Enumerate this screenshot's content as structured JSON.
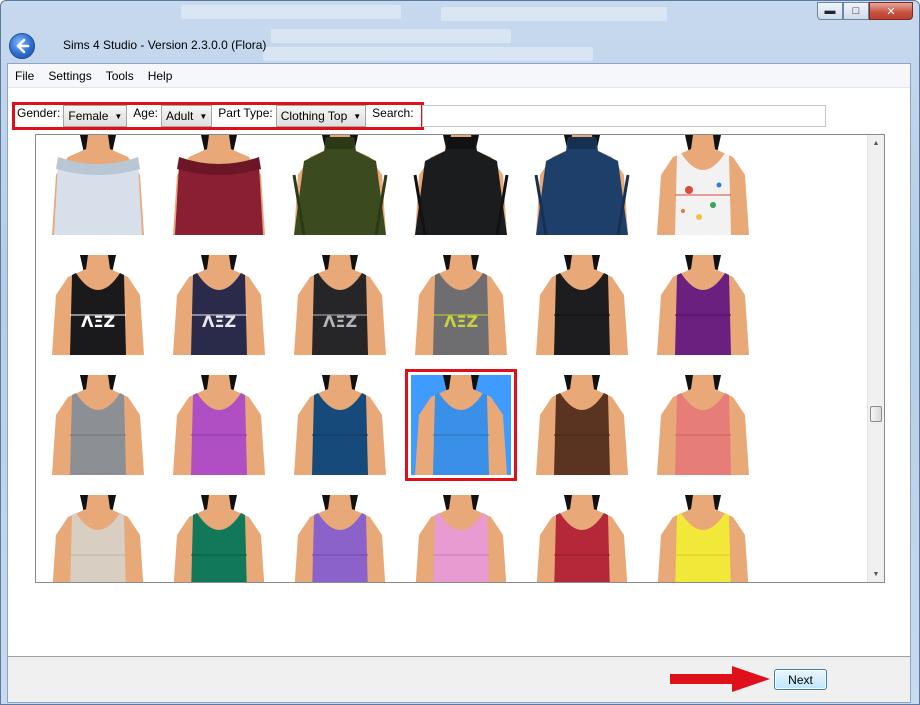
{
  "window": {
    "title": "Sims 4 Studio - Version 2.3.0.0  (Flora)",
    "buttons": {
      "minimize": "▬",
      "maximize": "□",
      "close": "✕"
    }
  },
  "menu": {
    "items": [
      "File",
      "Settings",
      "Tools",
      "Help"
    ]
  },
  "filters": {
    "gender_label": "Gender:",
    "gender_value": "Female",
    "age_label": "Age:",
    "age_value": "Adult",
    "part_type_label": "Part Type:",
    "part_type_value": "Clothing Top",
    "search_label": "Search:",
    "search_value": ""
  },
  "gallery": {
    "selected_index": 15,
    "tiles": [
      {
        "kind": "offshoulder",
        "color": "#d7e0ea",
        "accent": "#b9c6d4"
      },
      {
        "kind": "offshoulder",
        "color": "#8a1f33",
        "accent": "#6d1627"
      },
      {
        "kind": "turtleneck",
        "color": "#3b4a1f",
        "accent": "#2c3917"
      },
      {
        "kind": "turtleneck",
        "color": "#1b1c1e",
        "accent": "#101112"
      },
      {
        "kind": "turtleneck",
        "color": "#1f3f6b",
        "accent": "#16304f"
      },
      {
        "kind": "tank-splatter",
        "color": "#f2f2f2",
        "accent": "#d94a3a"
      },
      {
        "kind": "tank-print",
        "color": "#1a1a1c",
        "accent": "#ffffff"
      },
      {
        "kind": "tank-print",
        "color": "#2a2a4a",
        "accent": "#e8e8f0"
      },
      {
        "kind": "tank-print",
        "color": "#262629",
        "accent": "#b5b5b5"
      },
      {
        "kind": "tank-print",
        "color": "#6e6e70",
        "accent": "#c9d23a"
      },
      {
        "kind": "tank",
        "color": "#1d1d20",
        "accent": "#111113"
      },
      {
        "kind": "tank",
        "color": "#6b1f7e",
        "accent": "#521561"
      },
      {
        "kind": "tank",
        "color": "#8c8f93",
        "accent": "#72757a"
      },
      {
        "kind": "tank",
        "color": "#b04ec4",
        "accent": "#913da3"
      },
      {
        "kind": "tank",
        "color": "#154a7a",
        "accent": "#0f395f"
      },
      {
        "kind": "tank",
        "color": "#3a8fe6",
        "accent": "#2b74c2"
      },
      {
        "kind": "tank",
        "color": "#5a3420",
        "accent": "#452818"
      },
      {
        "kind": "tank",
        "color": "#e67d78",
        "accent": "#c96460"
      },
      {
        "kind": "tank",
        "color": "#d8cfc2",
        "accent": "#bdb3a5"
      },
      {
        "kind": "tank",
        "color": "#12785a",
        "accent": "#0c5d45"
      },
      {
        "kind": "tank",
        "color": "#8a62c9",
        "accent": "#704cab"
      },
      {
        "kind": "tank",
        "color": "#e79bd0",
        "accent": "#cb7fb4"
      },
      {
        "kind": "tank",
        "color": "#b5283a",
        "accent": "#93202e"
      },
      {
        "kind": "tank",
        "color": "#f2e83a",
        "accent": "#d6cb25"
      }
    ]
  },
  "footer": {
    "next_label": "Next"
  },
  "colors": {
    "highlight": "#e0101a",
    "selected_bg": "#3f9bff",
    "skin": "#e8a878"
  }
}
